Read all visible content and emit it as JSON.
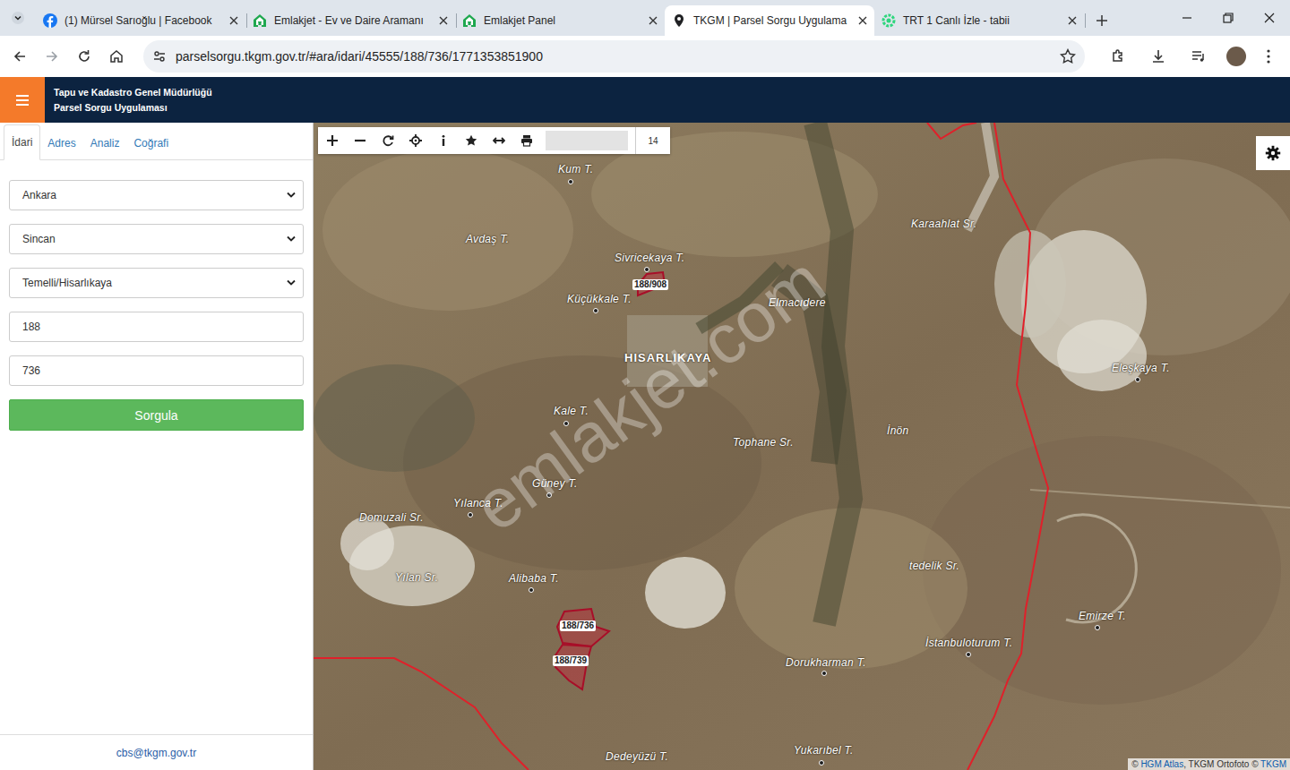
{
  "browser": {
    "tabs": [
      {
        "label": "(1) Mürsel Sarıoğlu | Facebook",
        "kind": "facebook",
        "selected": false
      },
      {
        "label": "Emlakjet - Ev ve Daire Aramanı",
        "kind": "emlakjet",
        "selected": false
      },
      {
        "label": "Emlakjet Panel",
        "kind": "emlakjet",
        "selected": false
      },
      {
        "label": "TKGM | Parsel Sorgu Uygulama",
        "kind": "pin",
        "selected": true
      },
      {
        "label": "TRT 1 Canlı İzle - tabii",
        "kind": "tabii",
        "selected": false
      }
    ],
    "url": "parselsorgu.tkgm.gov.tr/#ara/idari/45555/188/736/1771353851900"
  },
  "header": {
    "title_lines": [
      "Tapu ve Kadastro Genel Müdürlüğü",
      "Parsel Sorgu Uygulaması"
    ]
  },
  "panel": {
    "tabs": [
      {
        "label": "İdari",
        "selected": true
      },
      {
        "label": "Adres",
        "selected": false
      },
      {
        "label": "Analiz",
        "selected": false
      },
      {
        "label": "Coğrafi",
        "selected": false
      }
    ],
    "selects": [
      "Ankara",
      "Sincan",
      "Temelli/Hisarlıkaya"
    ],
    "inputs": [
      "188",
      "736"
    ],
    "button": "Sorgula",
    "footer": "cbs@tkgm.gov.tr"
  },
  "map": {
    "zoom": "14",
    "labels": [
      {
        "text": "Kum T.",
        "kind": "peak"
      },
      {
        "text": "Avdaş T.",
        "kind": "area"
      },
      {
        "text": "Sivricekaya T.",
        "kind": "peak"
      },
      {
        "text": "Küçükkale T.",
        "kind": "peak"
      },
      {
        "text": "Elmacıdere",
        "kind": "area"
      },
      {
        "text": "HISARLIKAYA",
        "kind": "village"
      },
      {
        "text": "Karaahlat Sr.",
        "kind": "area"
      },
      {
        "text": "Eleşkaya T.",
        "kind": "peak"
      },
      {
        "text": "Kale T.",
        "kind": "peak"
      },
      {
        "text": "Tophane Sr.",
        "kind": "area"
      },
      {
        "text": "İnön",
        "kind": "area"
      },
      {
        "text": "Güney T.",
        "kind": "peak"
      },
      {
        "text": "Yılanca T.",
        "kind": "peak"
      },
      {
        "text": "Domuzali Sr.",
        "kind": "area"
      },
      {
        "text": "Yılan Sr.",
        "kind": "area"
      },
      {
        "text": "Alibaba T.",
        "kind": "peak"
      },
      {
        "text": "tedelik Sr.",
        "kind": "area"
      },
      {
        "text": "Emirze T.",
        "kind": "peak"
      },
      {
        "text": "İstanbuloturum T.",
        "kind": "peak"
      },
      {
        "text": "Dorukharman T.",
        "kind": "peak"
      },
      {
        "text": "Yukarıbel T.",
        "kind": "peak"
      },
      {
        "text": "Dedeyüzü T.",
        "kind": "area"
      }
    ],
    "parcels": [
      {
        "label": "188/908"
      },
      {
        "label": "188/736"
      },
      {
        "label": "188/739"
      }
    ],
    "watermark": "emlakjet.com",
    "attribution": [
      {
        "text": "© ",
        "link": false
      },
      {
        "text": "HGM Atlas",
        "link": true
      },
      {
        "text": ", TKGM Ortofoto © ",
        "link": false
      },
      {
        "text": "TKGM",
        "link": true
      }
    ]
  }
}
